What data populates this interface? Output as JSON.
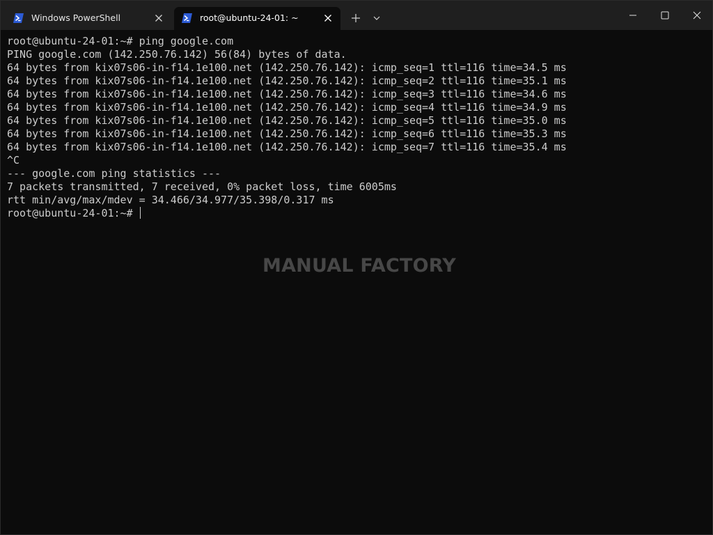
{
  "tabs": [
    {
      "title": "Windows PowerShell",
      "icon": "powershell-icon",
      "active": false
    },
    {
      "title": "root@ubuntu-24-01: ~",
      "icon": "powershell-icon",
      "active": true
    }
  ],
  "tab_strip": {
    "new_tab_icon": "plus-icon",
    "dropdown_icon": "chevron-down-icon"
  },
  "window_controls": {
    "minimize_icon": "minimize-icon",
    "maximize_icon": "maximize-icon",
    "close_icon": "close-icon"
  },
  "colors": {
    "background": "#0c0c0c",
    "titlebar": "#1f1f1f",
    "text": "#cccccc",
    "icon_accent": "#2c5bd5",
    "watermark": "#474747"
  },
  "terminal": {
    "lines": [
      "root@ubuntu-24-01:~# ping google.com",
      "PING google.com (142.250.76.142) 56(84) bytes of data.",
      "64 bytes from kix07s06-in-f14.1e100.net (142.250.76.142): icmp_seq=1 ttl=116 time=34.5 ms",
      "64 bytes from kix07s06-in-f14.1e100.net (142.250.76.142): icmp_seq=2 ttl=116 time=35.1 ms",
      "64 bytes from kix07s06-in-f14.1e100.net (142.250.76.142): icmp_seq=3 ttl=116 time=34.6 ms",
      "64 bytes from kix07s06-in-f14.1e100.net (142.250.76.142): icmp_seq=4 ttl=116 time=34.9 ms",
      "64 bytes from kix07s06-in-f14.1e100.net (142.250.76.142): icmp_seq=5 ttl=116 time=35.0 ms",
      "64 bytes from kix07s06-in-f14.1e100.net (142.250.76.142): icmp_seq=6 ttl=116 time=35.3 ms",
      "64 bytes from kix07s06-in-f14.1e100.net (142.250.76.142): icmp_seq=7 ttl=116 time=35.4 ms",
      "^C",
      "--- google.com ping statistics ---",
      "7 packets transmitted, 7 received, 0% packet loss, time 6005ms",
      "rtt min/avg/max/mdev = 34.466/34.977/35.398/0.317 ms"
    ],
    "prompt": "root@ubuntu-24-01:~# "
  },
  "watermark": "MANUAL FACTORY"
}
